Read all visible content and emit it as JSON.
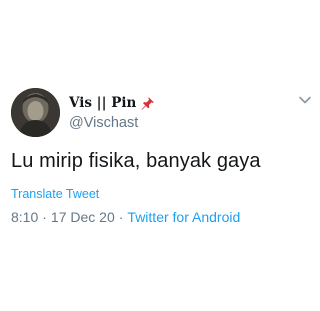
{
  "tweet": {
    "display_name": "Vis || Pin",
    "handle": "@Vischast",
    "text": "Lu mirip fisika, banyak gaya",
    "translate_label": "Translate Tweet",
    "time": "8:10",
    "date": "17 Dec 20",
    "separator": "·",
    "client": "Twitter for Android"
  },
  "icons": {
    "name_badge": "pushpin-icon",
    "menu": "chevron-down-icon"
  },
  "colors": {
    "link": "#1da1f2",
    "secondary_text": "#657786",
    "primary_text": "#14171a",
    "pin": "#d9303a"
  }
}
